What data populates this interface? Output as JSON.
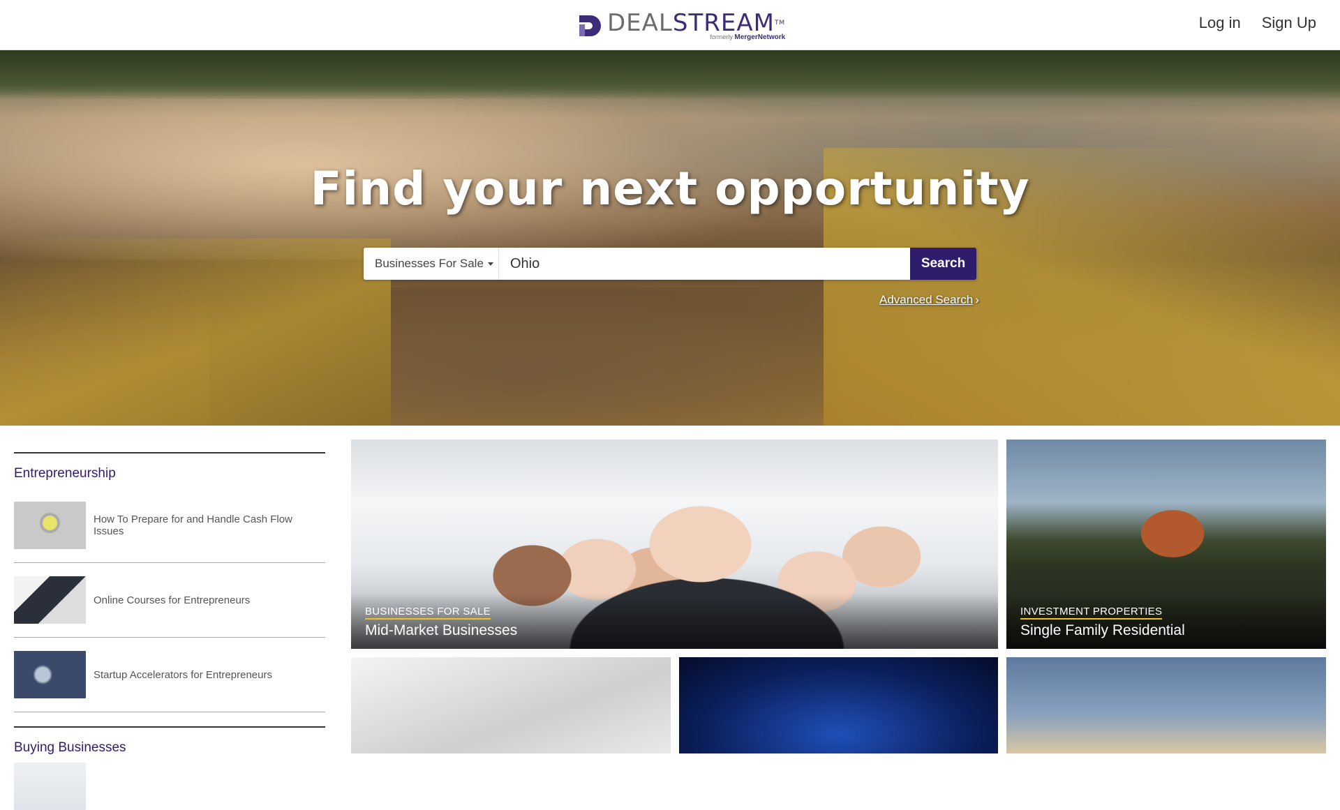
{
  "header": {
    "logo": {
      "word_left": "DEAL",
      "word_right": "STREAM",
      "trademark": "TM",
      "formerly_label": "formerly",
      "formerly_name": "MergerNetwork"
    },
    "nav": {
      "login": "Log in",
      "signup": "Sign Up"
    }
  },
  "hero": {
    "title": "Find your next opportunity",
    "search": {
      "category_selected": "Businesses For Sale",
      "query_value": "Ohio",
      "button_label": "Search",
      "advanced_label": "Advanced Search"
    }
  },
  "sidebar": {
    "sections": [
      {
        "heading": "Entrepreneurship",
        "items": [
          {
            "title": "How To Prepare for and Handle Cash Flow Issues"
          },
          {
            "title": "Online Courses for Entrepreneurs"
          },
          {
            "title": "Startup Accelerators for Entrepreneurs"
          }
        ]
      },
      {
        "heading": "Buying Businesses"
      }
    ]
  },
  "tiles": {
    "mid_market": {
      "category": "BUSINESSES FOR SALE",
      "title": "Mid-Market Businesses"
    },
    "single_family": {
      "category": "INVESTMENT PROPERTIES",
      "title": "Single Family Residential"
    }
  },
  "colors": {
    "brand_purple": "#2f1d6b",
    "accent_gold": "#f0c419"
  }
}
